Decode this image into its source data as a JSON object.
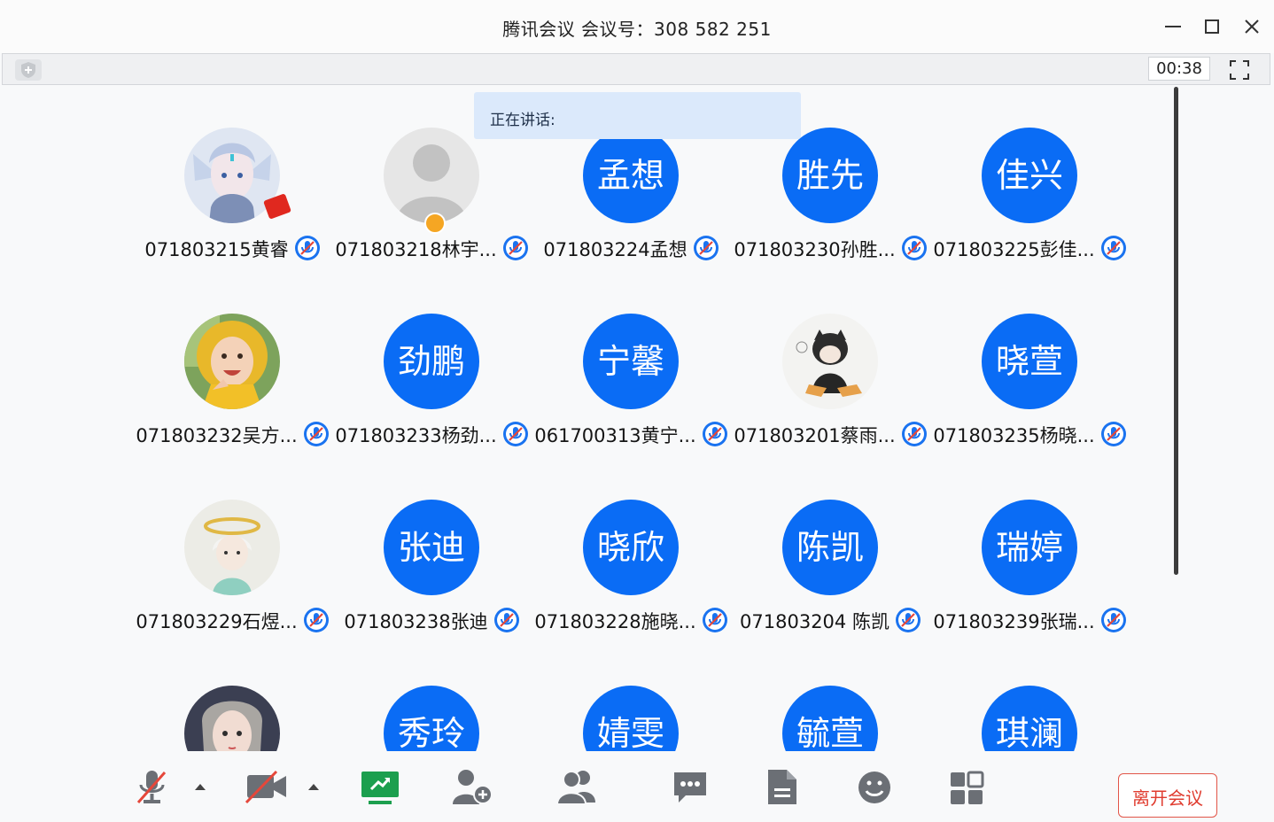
{
  "window": {
    "title": "腾讯会议 会议号：308 582 251"
  },
  "toolbar": {
    "timer": "00:38"
  },
  "speaking": {
    "label": "正在讲话:"
  },
  "participants": [
    {
      "name": "071803215黄睿",
      "avatar": "photo-anime-elf"
    },
    {
      "name": "071803218林宇...",
      "avatar": "default-silhouette"
    },
    {
      "name": "071803224孟想",
      "avatar_text": "孟想"
    },
    {
      "name": "071803230孙胜...",
      "avatar_text": "胜先"
    },
    {
      "name": "071803225彭佳...",
      "avatar_text": "佳兴"
    },
    {
      "name": "071803232吴方...",
      "avatar": "photo-child-yellow-hat"
    },
    {
      "name": "071803233杨劲...",
      "avatar_text": "劲鹏"
    },
    {
      "name": "061700313黄宁...",
      "avatar_text": "宁馨"
    },
    {
      "name": "071803201蔡雨...",
      "avatar": "photo-cat-sketch"
    },
    {
      "name": "071803235杨晓...",
      "avatar_text": "晓萱"
    },
    {
      "name": "071803229石煜...",
      "avatar": "photo-anime-boy-halo"
    },
    {
      "name": "071803238张迪",
      "avatar_text": "张迪"
    },
    {
      "name": "071803228施晓...",
      "avatar_text": "晓欣"
    },
    {
      "name": "071803204 陈凯",
      "avatar_text": "陈凯"
    },
    {
      "name": "071803239张瑞...",
      "avatar_text": "瑞婷"
    },
    {
      "name": "",
      "avatar": "photo-anime-girl"
    },
    {
      "name": "",
      "avatar_text": "秀玲"
    },
    {
      "name": "",
      "avatar_text": "婧雯"
    },
    {
      "name": "",
      "avatar_text": "毓萱"
    },
    {
      "name": "",
      "avatar_text": "琪澜"
    }
  ],
  "bottom_bar": {
    "icons": [
      "mic-muted-icon",
      "caret-up-icon",
      "camera-off-icon",
      "caret-up-icon",
      "share-screen-icon",
      "invite-icon",
      "participants-icon",
      "chat-icon",
      "document-icon",
      "emoji-icon",
      "apps-icon"
    ],
    "leave_label": "离开会议"
  },
  "colors": {
    "avatar_blue": "#0a6cf5",
    "leave_red": "#e03c2f",
    "speaking_bg": "#dbe9fb"
  }
}
